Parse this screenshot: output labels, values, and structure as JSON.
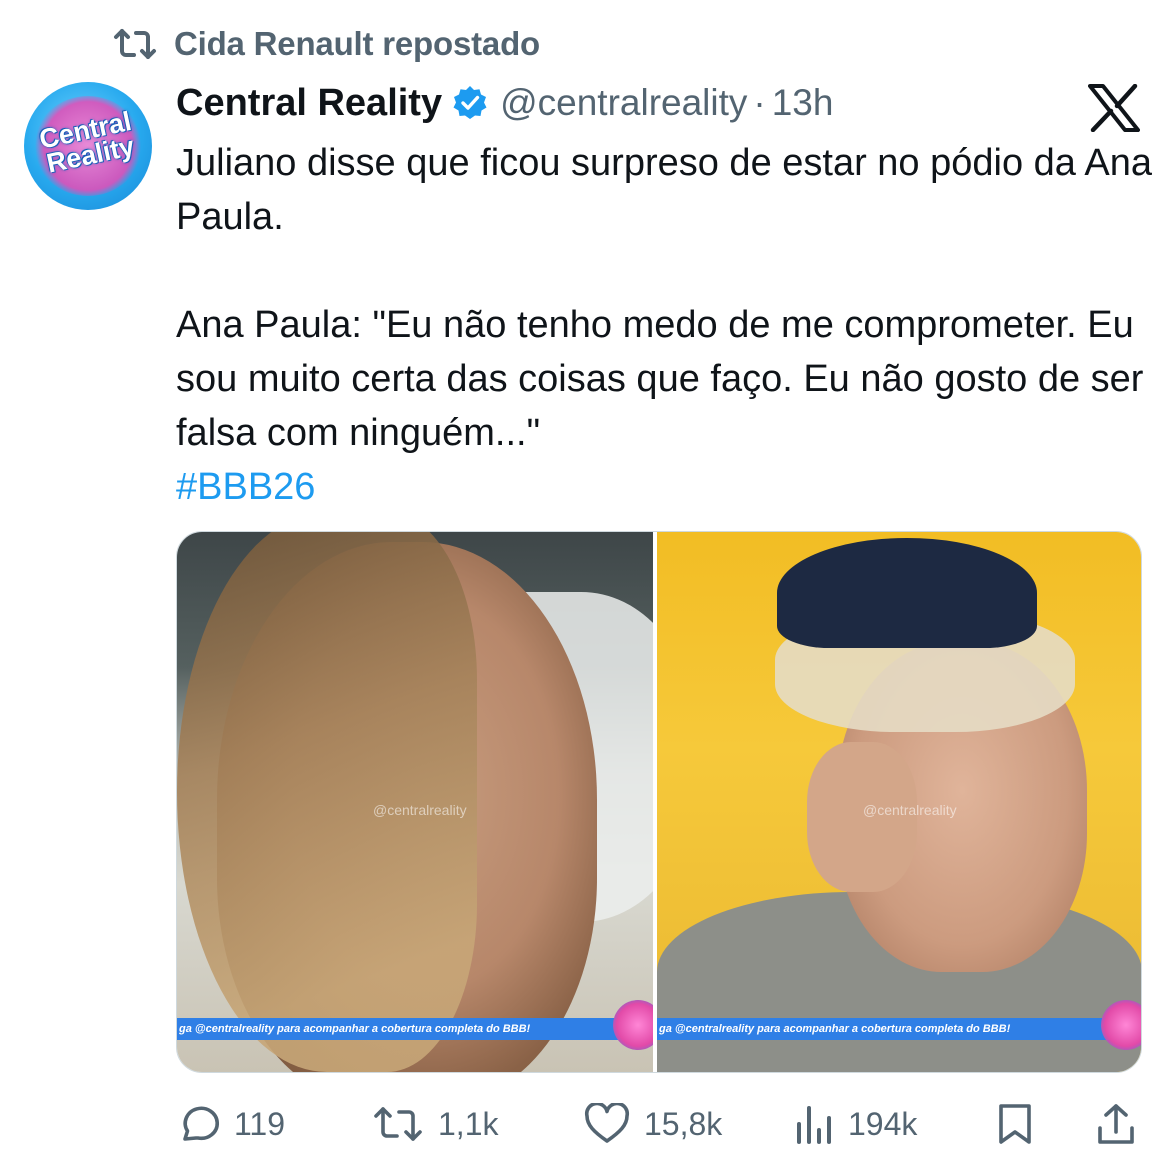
{
  "repost_banner": {
    "text": "Cida Renault repostado",
    "icon": "repost-icon"
  },
  "author": {
    "avatar_text": "Central Reality",
    "display_name": "Central Reality",
    "verified_icon": "verified-badge-icon",
    "handle": "@centralreality",
    "separator": "·",
    "time": "13h"
  },
  "platform_icon": "x-logo-icon",
  "tweet": {
    "line1": "Juliano disse que ficou surpreso de estar no pódio da Ana Paula.",
    "line2": "Ana Paula: \"Eu não tenho medo de me comprometer. Eu sou muito certa das coisas que faço. Eu não gosto de ser falsa com ninguém...\"",
    "hashtag": "#BBB26"
  },
  "media": {
    "left": {
      "watermark": "@centralreality",
      "ticker": "ga @centralreality para acompanhar a cobertura completa do BBB!"
    },
    "right": {
      "watermark": "@centralreality",
      "ticker": "ga @centralreality para acompanhar a cobertura completa do BBB!"
    }
  },
  "actions": {
    "reply_count": "119",
    "repost_count": "1,1k",
    "like_count": "15,8k",
    "views_count": "194k"
  },
  "colors": {
    "text": "#0f1419",
    "secondary": "#536471",
    "link": "#1d9bf0",
    "verified": "#1d9bf0"
  }
}
